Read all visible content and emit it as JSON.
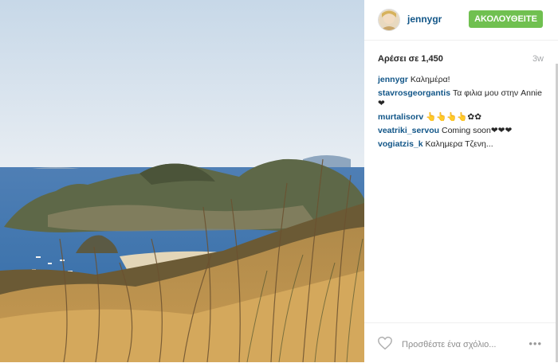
{
  "header": {
    "username": "jennygr",
    "follow_label": "ΑΚΟΛΟΥΘΕΙΤΕ"
  },
  "stats": {
    "likes": "Αρέσει σε 1,450",
    "age": "3w"
  },
  "comments": [
    {
      "user": "jennygr",
      "text": "Καλημέρα!"
    },
    {
      "user": "stavrosgeorgantis",
      "text": "Τα φιλια μου στην Annie ❤"
    },
    {
      "user": "murtalisorv",
      "text": "👆👆👆👆✿✿"
    },
    {
      "user": "veatriki_servou",
      "text": "Coming soon❤❤❤"
    },
    {
      "user": "vogiatzis_k",
      "text": "Καλημερα Τζενη..."
    }
  ],
  "footer": {
    "add_comment_placeholder": "Προσθέστε ένα σχόλιο...",
    "more_label": "•••"
  },
  "colors": {
    "follow": "#70c050",
    "username": "#125688"
  },
  "icons": {
    "like": "heart-icon",
    "more": "more-icon"
  }
}
